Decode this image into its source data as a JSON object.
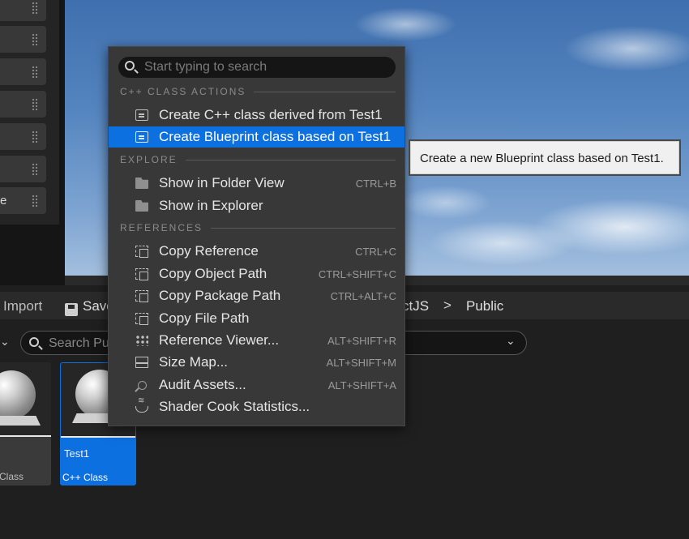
{
  "details_panel": {
    "row_fragment": "e"
  },
  "content_browser": {
    "toolbar": {
      "import_label": "Import",
      "save_label": "Save",
      "path_partial": "ctJS",
      "path_separator": ">",
      "path_current": "Public"
    },
    "search": {
      "placeholder": "Search Pu"
    },
    "assets": [
      {
        "name": "",
        "type": "Class",
        "selected": false
      },
      {
        "name": "Test1",
        "type": "C++ Class",
        "selected": true
      }
    ]
  },
  "context_menu": {
    "search_placeholder": "Start typing to search",
    "sections": [
      {
        "title": "C++ CLASS ACTIONS",
        "items": [
          {
            "label": "Create C++ class derived from Test1",
            "shortcut": "",
            "icon": "class-icon",
            "highlighted": false
          },
          {
            "label": "Create Blueprint class based on Test1",
            "shortcut": "",
            "icon": "blueprint-class-icon",
            "highlighted": true
          }
        ]
      },
      {
        "title": "EXPLORE",
        "items": [
          {
            "label": "Show in Folder View",
            "shortcut": "CTRL+B",
            "icon": "folder-search-icon"
          },
          {
            "label": "Show in Explorer",
            "shortcut": "",
            "icon": "folder-search-icon"
          }
        ]
      },
      {
        "title": "REFERENCES",
        "items": [
          {
            "label": "Copy Reference",
            "shortcut": "CTRL+C",
            "icon": "copy-icon"
          },
          {
            "label": "Copy Object Path",
            "shortcut": "CTRL+SHIFT+C",
            "icon": "copy-icon"
          },
          {
            "label": "Copy Package Path",
            "shortcut": "CTRL+ALT+C",
            "icon": "copy-icon"
          },
          {
            "label": "Copy File Path",
            "shortcut": "",
            "icon": "copy-icon"
          },
          {
            "label": "Reference Viewer...",
            "shortcut": "ALT+SHIFT+R",
            "icon": "reference-graph-icon"
          },
          {
            "label": "Size Map...",
            "shortcut": "ALT+SHIFT+M",
            "icon": "size-map-icon"
          },
          {
            "label": "Audit Assets...",
            "shortcut": "ALT+SHIFT+A",
            "icon": "audit-icon"
          },
          {
            "label": "Shader Cook Statistics...",
            "shortcut": "",
            "icon": "shader-icon"
          }
        ]
      }
    ]
  },
  "tooltip": {
    "text": "Create a new Blueprint class based on Test1."
  },
  "colors": {
    "highlight": "#0d70e0",
    "menu_bg": "#383838"
  }
}
